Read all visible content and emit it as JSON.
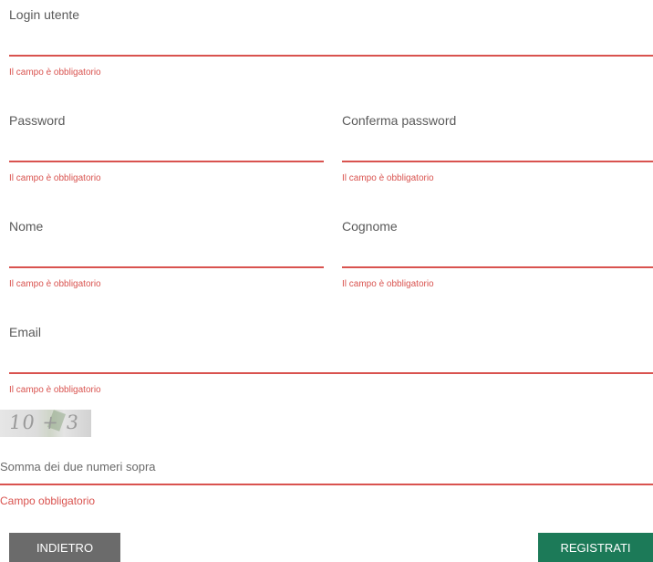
{
  "fields": {
    "login": {
      "label": "Login utente",
      "value": "",
      "error": "Il campo è obbligatorio"
    },
    "password": {
      "label": "Password",
      "value": "",
      "error": "Il campo è obbligatorio"
    },
    "confirm_password": {
      "label": "Conferma password",
      "value": "",
      "error": "Il campo è obbligatorio"
    },
    "nome": {
      "label": "Nome",
      "value": "",
      "error": "Il campo è obbligatorio"
    },
    "cognome": {
      "label": "Cognome",
      "value": "",
      "error": "Il campo è obbligatorio"
    },
    "email": {
      "label": "Email",
      "value": "",
      "error": "Il campo è obbligatorio"
    }
  },
  "captcha": {
    "image_text": "10 + 3",
    "label": "Somma dei due numeri sopra",
    "value": "",
    "error": "Campo obbligatorio"
  },
  "buttons": {
    "back": "INDIETRO",
    "register": "REGISTRATI"
  },
  "colors": {
    "error": "#d9534f",
    "register_button": "#1c7a58",
    "back_button": "#6b6b6b"
  }
}
